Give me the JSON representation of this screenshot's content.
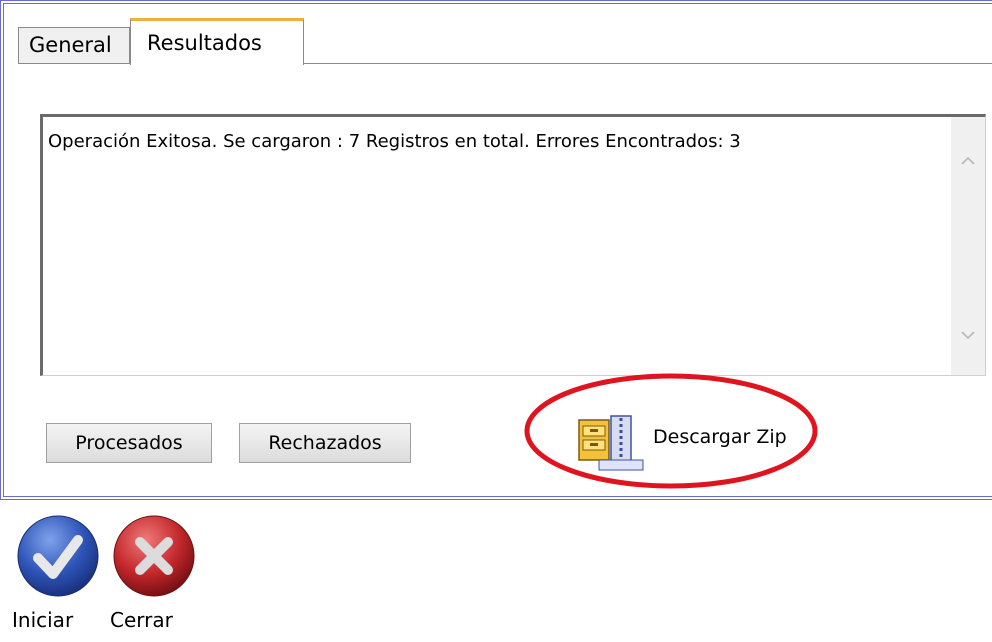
{
  "tabs": [
    {
      "label": "General",
      "active": false
    },
    {
      "label": "Resultados",
      "active": true
    }
  ],
  "results": {
    "message": "Operación Exitosa. Se cargaron : 7 Registros en total. Errores Encontrados: 3"
  },
  "buttons": {
    "procesados": "Procesados",
    "rechazados": "Rechazados",
    "download_zip": "Descargar Zip"
  },
  "actions": {
    "start": {
      "label": "Iniciar",
      "icon": "check-icon",
      "color": "#2f55b8"
    },
    "close": {
      "label": "Cerrar",
      "icon": "x-icon",
      "color": "#c4282c"
    }
  },
  "annotation_color": "#e0141e"
}
